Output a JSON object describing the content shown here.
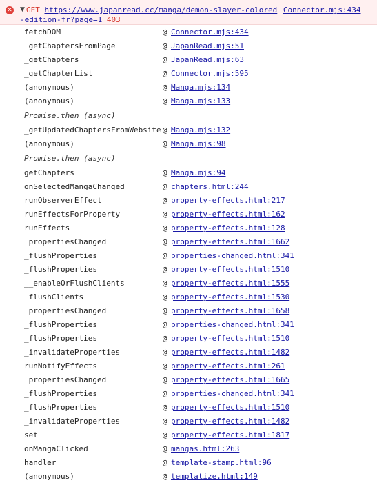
{
  "error": {
    "method": "GET",
    "url_part1": "https://www.japanread.cc/manga/demon-slayer-colored",
    "url_part2": "-edition-fr?page=1",
    "status": "403",
    "source": "Connector.mjs:434"
  },
  "stack": [
    {
      "fn": "fetchDOM",
      "loc": "Connector.mjs:434"
    },
    {
      "fn": "_getChaptersFromPage",
      "loc": "JapanRead.mjs:51"
    },
    {
      "fn": "_getChapters",
      "loc": "JapanRead.mjs:63"
    },
    {
      "fn": "_getChapterList",
      "loc": "Connector.mjs:595"
    },
    {
      "fn": "(anonymous)",
      "loc": "Manga.mjs:134"
    },
    {
      "fn": "(anonymous)",
      "loc": "Manga.mjs:133"
    },
    {
      "async": "Promise.then (async)"
    },
    {
      "fn": "_getUpdatedChaptersFromWebsite",
      "loc": "Manga.mjs:132"
    },
    {
      "fn": "(anonymous)",
      "loc": "Manga.mjs:98"
    },
    {
      "async": "Promise.then (async)"
    },
    {
      "fn": "getChapters",
      "loc": "Manga.mjs:94"
    },
    {
      "fn": "onSelectedMangaChanged",
      "loc": "chapters.html:244"
    },
    {
      "fn": "runObserverEffect",
      "loc": "property-effects.html:217"
    },
    {
      "fn": "runEffectsForProperty",
      "loc": "property-effects.html:162"
    },
    {
      "fn": "runEffects",
      "loc": "property-effects.html:128"
    },
    {
      "fn": "_propertiesChanged",
      "loc": "property-effects.html:1662"
    },
    {
      "fn": "_flushProperties",
      "loc": "properties-changed.html:341"
    },
    {
      "fn": "_flushProperties",
      "loc": "property-effects.html:1510"
    },
    {
      "fn": "__enableOrFlushClients",
      "loc": "property-effects.html:1555"
    },
    {
      "fn": "_flushClients",
      "loc": "property-effects.html:1530"
    },
    {
      "fn": "_propertiesChanged",
      "loc": "property-effects.html:1658"
    },
    {
      "fn": "_flushProperties",
      "loc": "properties-changed.html:341"
    },
    {
      "fn": "_flushProperties",
      "loc": "property-effects.html:1510"
    },
    {
      "fn": "_invalidateProperties",
      "loc": "property-effects.html:1482"
    },
    {
      "fn": "runNotifyEffects",
      "loc": "property-effects.html:261"
    },
    {
      "fn": "_propertiesChanged",
      "loc": "property-effects.html:1665"
    },
    {
      "fn": "_flushProperties",
      "loc": "properties-changed.html:341"
    },
    {
      "fn": "_flushProperties",
      "loc": "property-effects.html:1510"
    },
    {
      "fn": "_invalidateProperties",
      "loc": "property-effects.html:1482"
    },
    {
      "fn": "set",
      "loc": "property-effects.html:1817"
    },
    {
      "fn": "onMangaClicked",
      "loc": "mangas.html:263"
    },
    {
      "fn": "handler",
      "loc": "template-stamp.html:96"
    },
    {
      "fn": "(anonymous)",
      "loc": "templatize.html:149"
    }
  ],
  "at_symbol": "@",
  "colors": {
    "error_bg": "#fff0f0",
    "error_text": "#d6392f",
    "link": "#1a1aa6"
  },
  "icons": {
    "error": "error-circle-icon",
    "expand": "triangle-down-icon"
  }
}
